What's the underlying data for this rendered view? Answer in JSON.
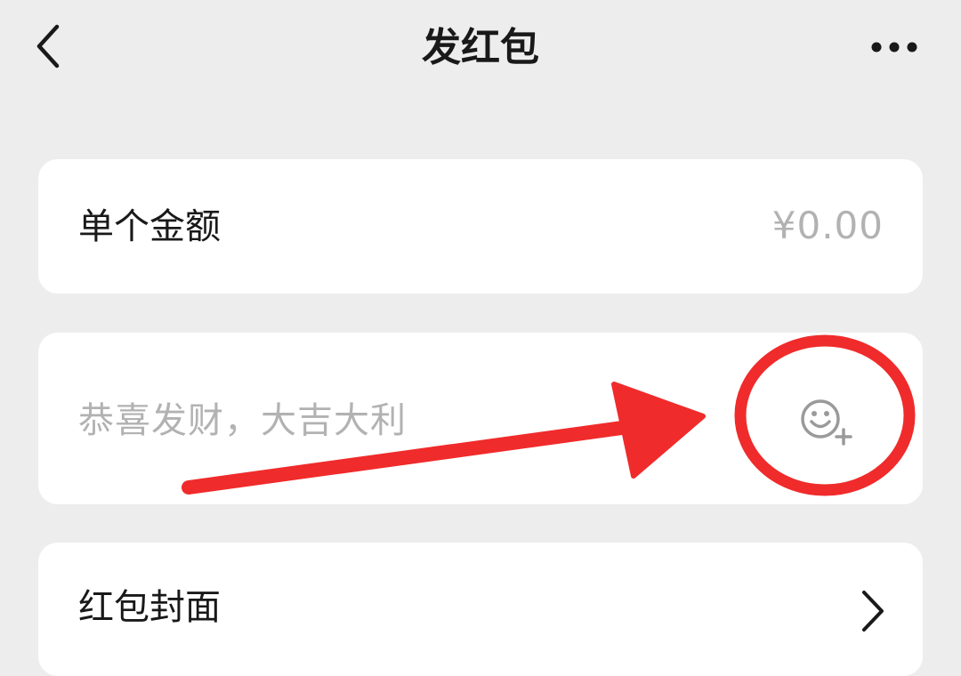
{
  "nav": {
    "title": "发红包",
    "back_icon": "chevron-left-icon",
    "more_icon": "more-dots-icon"
  },
  "amount": {
    "label": "单个金额",
    "value": "¥0.00"
  },
  "greeting": {
    "placeholder": "恭喜发财，大吉大利",
    "emoji_icon": "emoji-add-icon"
  },
  "cover": {
    "label": "红包封面",
    "chevron_icon": "chevron-right-icon"
  },
  "colors": {
    "background": "#ededed",
    "card": "#ffffff",
    "text_primary": "#191919",
    "text_placeholder": "#b2b2b2",
    "annotation_red": "#f02b2b"
  },
  "annotation": {
    "type": "red-circle-and-arrow",
    "target": "emoji-add-icon"
  }
}
